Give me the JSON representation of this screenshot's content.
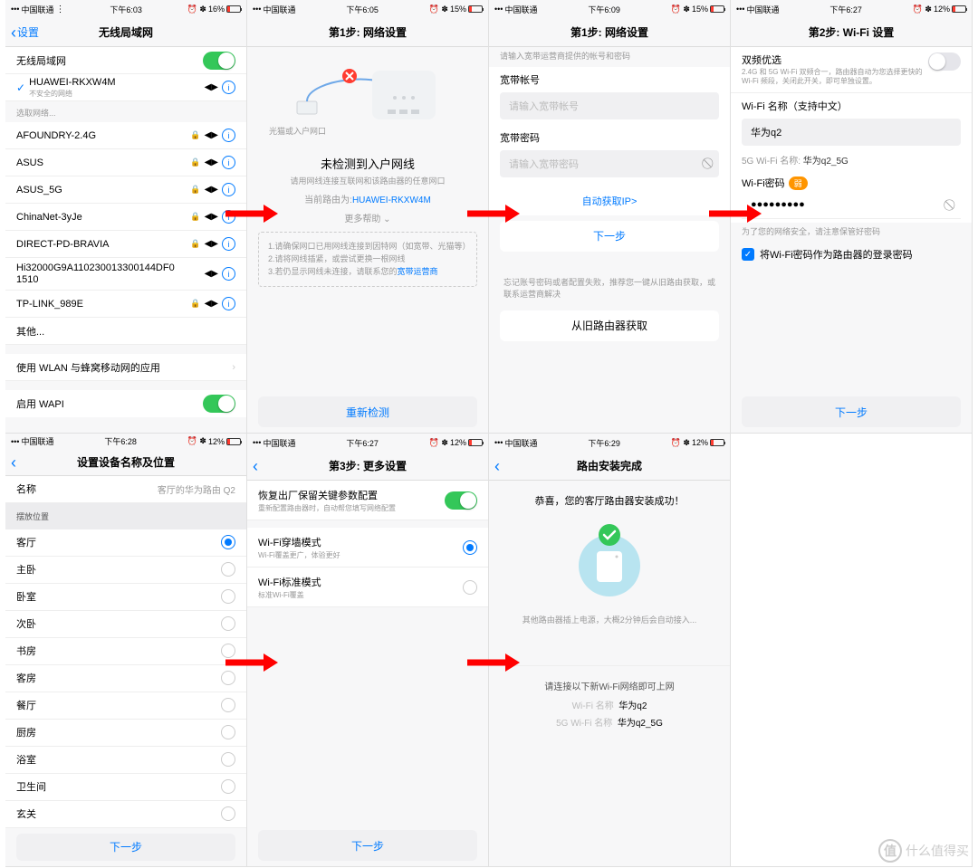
{
  "status": {
    "carrier": "中国联通",
    "carrier_prefix": "••• ",
    "signal": "•••",
    "times": [
      "下午6:03",
      "下午6:05",
      "下午6:09",
      "下午6:27",
      "下午6:28",
      "下午6:27",
      "下午6:29"
    ],
    "right_icons": "⏰ ✽",
    "battery_levels": [
      "16%",
      "15%",
      "15%",
      "12%",
      "12%",
      "12%",
      "12%"
    ]
  },
  "s1": {
    "back": "设置",
    "title": "无线局域网",
    "wlan_label": "无线局域网",
    "connected": {
      "ssid": "HUAWEI-RKXW4M",
      "note": "不安全的网络"
    },
    "select_header": "选取网络...",
    "nets": [
      {
        "ssid": "AFOUNDRY-2.4G",
        "lock": true
      },
      {
        "ssid": "ASUS",
        "lock": true
      },
      {
        "ssid": "ASUS_5G",
        "lock": true
      },
      {
        "ssid": "ChinaNet-3yJe",
        "lock": true
      },
      {
        "ssid": "DIRECT-PD-BRAVIA",
        "lock": true
      },
      {
        "ssid": "Hi32000G9A110230013300144DF01510",
        "lock": false
      },
      {
        "ssid": "TP-LINK_989E",
        "lock": true
      }
    ],
    "other": "其他...",
    "apps_row": "使用 WLAN 与蜂窝移动网的应用",
    "wapi": "启用 WAPI"
  },
  "s2": {
    "title": "第1步: 网络设置",
    "ill_caption": "光猫或入户网口",
    "headline": "未检测到入户网线",
    "sub": "请用网线连接互联网和该路由器的任意网口",
    "current_router_prefix": "当前路由为:",
    "current_router": "HUAWEI-RKXW4M",
    "more_help": "更多帮助 ⌄",
    "tips": {
      "l1": "1.请确保网口已用网线连接到因特网（如宽带、光猫等）",
      "l2": "2.请将网线插紧，或尝试更换一根网线",
      "l3a": "3.若仍显示网线未连接，请联系您的",
      "l3b": "宽带运营商"
    },
    "retry": "重新检测"
  },
  "s3": {
    "title": "第1步: 网络设置",
    "hint_top": "请输入宽带运营商提供的帐号和密码",
    "acct_label": "宽带帐号",
    "acct_ph": "请输入宽带帐号",
    "pwd_label": "宽带密码",
    "pwd_ph": "请输入宽带密码",
    "auto_ip": "自动获取IP>",
    "next": "下一步",
    "forgot_hint": "忘记账号密码或者配置失败，推荐您一键从旧路由获取，或联系运营商解决",
    "from_old": "从旧路由器获取"
  },
  "s4": {
    "title": "第2步: Wi-Fi 设置",
    "dual_title": "双频优选",
    "dual_sub": "2.4G 和 5G Wi-Fi 双频合一，路由器自动为您选择更快的Wi-Fi 频段，关闭此开关，即可单独设置。",
    "name_label": "Wi-Fi 名称（支持中文）",
    "name_val": "华为q2",
    "name_5g_prefix": "5G Wi-Fi 名称: ",
    "name_5g": "华为q2_5G",
    "pwd_label": "Wi-Fi密码",
    "pwd_badge": "弱",
    "pwd_val": "●●●●●●●●●",
    "pwd_note": "为了您的网络安全，请注意保管好密码",
    "checkbox_label": "将Wi-Fi密码作为路由器的登录密码",
    "next": "下一步"
  },
  "s5": {
    "title": "设置设备名称及位置",
    "name_label": "名称",
    "name_val": "客厅的华为路由 Q2",
    "pos_header": "摆放位置",
    "rooms": [
      "客厅",
      "主卧",
      "卧室",
      "次卧",
      "书房",
      "客房",
      "餐厅",
      "厨房",
      "浴室",
      "卫生间",
      "玄关"
    ],
    "selected": 0,
    "next": "下一步"
  },
  "s6": {
    "title": "第3步: 更多设置",
    "opt1": "恢复出厂保留关键参数配置",
    "opt1_sub": "重新配置路由器时，自动帮您填写网络配置",
    "opt2": "Wi-Fi穿墙模式",
    "opt2_sub": "Wi-Fi覆盖更广，体验更好",
    "opt3": "Wi-Fi标准模式",
    "opt3_sub": "标准Wi-Fi覆盖",
    "next": "下一步"
  },
  "s7": {
    "title": "路由安装完成",
    "congrats": "恭喜，您的客厅路由器安装成功！",
    "note": "其他路由器插上电源，大概2分钟后会自动接入...",
    "connect_hint": "请连接以下新Wi-Fi网络即可上网",
    "wifi_lbl": "Wi-Fi 名称",
    "wifi_val": "华为q2",
    "wifi5_lbl": "5G Wi-Fi 名称",
    "wifi5_val": "华为q2_5G"
  },
  "watermark": {
    "logo": "值",
    "text": "什么值得买"
  }
}
